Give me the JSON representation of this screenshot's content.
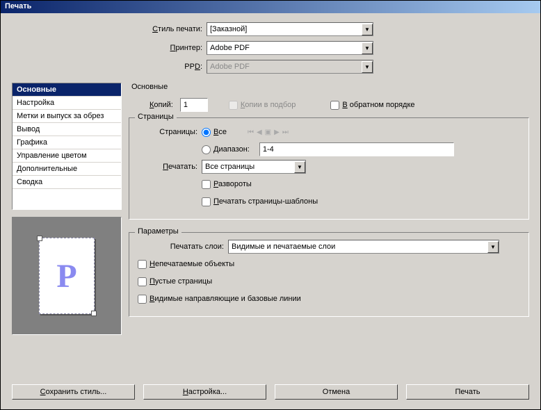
{
  "window": {
    "title": "Печать"
  },
  "top": {
    "style_label": "Стиль печати:",
    "style_value": "[Заказной]",
    "printer_label": "Принтер:",
    "printer_value": "Adobe PDF",
    "ppd_label": "PPD:",
    "ppd_value": "Adobe PDF"
  },
  "sidebar": {
    "items": [
      "Основные",
      "Настройка",
      "Метки и выпуск за обрез",
      "Вывод",
      "Графика",
      "Управление цветом",
      "Дополнительные",
      "Сводка"
    ],
    "selected_index": 0
  },
  "main": {
    "title": "Основные",
    "copies_label": "Копий:",
    "copies_value": "1",
    "collate_label": "Копии в подбор",
    "reverse_label": "В обратном порядке",
    "pages_group": "Страницы",
    "pages_label": "Страницы:",
    "pages_all": "Все",
    "pages_range": "Диапазон:",
    "range_value": "1-4",
    "print_label": "Печатать:",
    "print_value": "Все страницы",
    "spreads_label": "Развороты",
    "masters_label": "Печатать страницы-шаблоны",
    "params_group": "Параметры",
    "layers_label": "Печатать слои:",
    "layers_value": "Видимые и печатаемые слои",
    "nonprinting_label": "Непечатаемые объекты",
    "blank_label": "Пустые страницы",
    "guides_label": "Видимые направляющие и базовые линии"
  },
  "buttons": {
    "save_style": "Сохранить стиль...",
    "setup": "Настройка...",
    "cancel": "Отмена",
    "print": "Печать"
  },
  "preview": {
    "glyph": "P"
  }
}
